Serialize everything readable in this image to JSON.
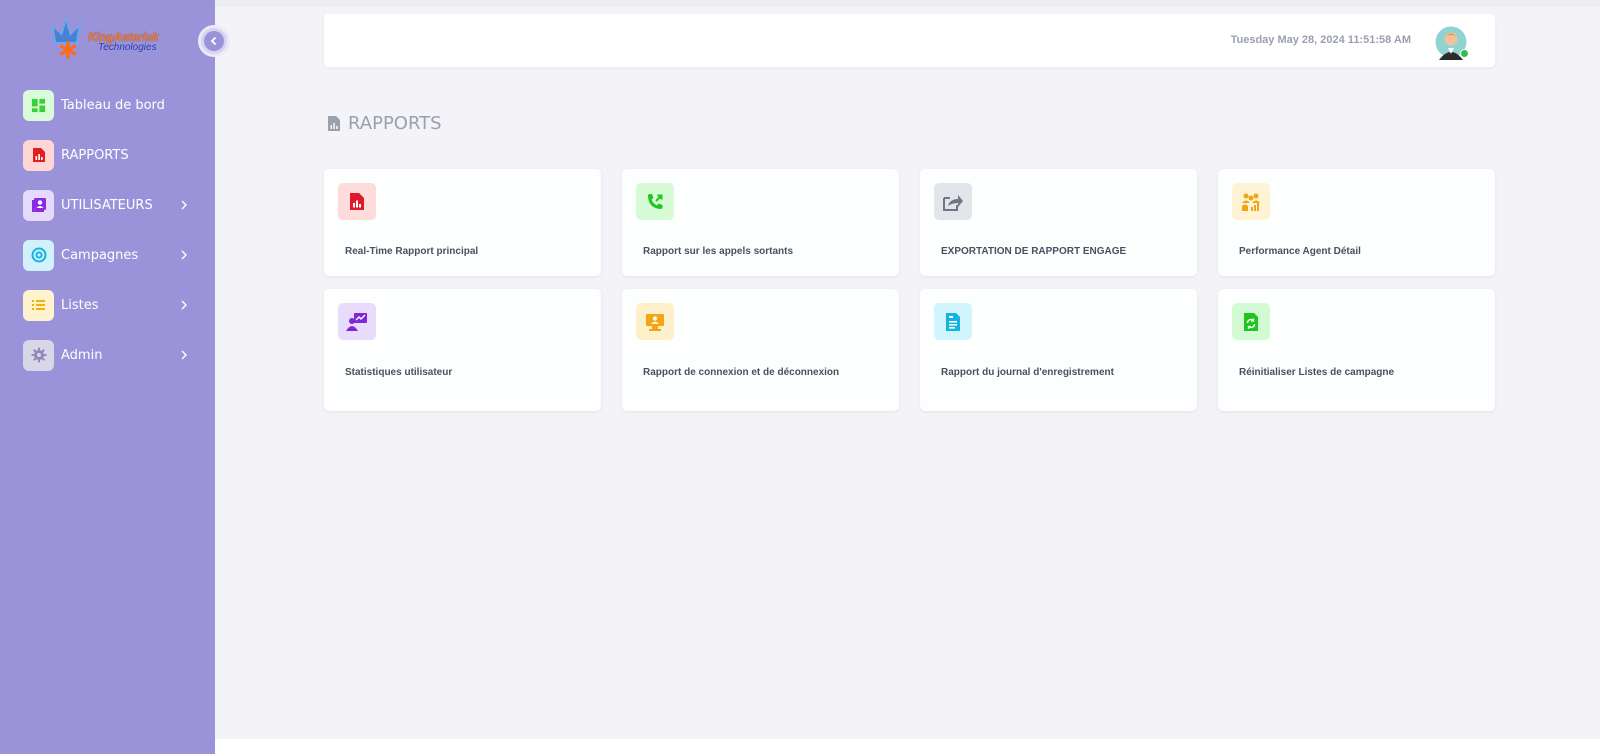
{
  "app": {
    "logo_line1": "KingAsterisk",
    "logo_line2": "Technologies"
  },
  "sidebar": {
    "items": [
      {
        "label": "Tableau de bord",
        "icon": "dashboard-icon",
        "bg": "#d9fbd9",
        "fg": "#35d135"
      },
      {
        "label": "RAPPORTS",
        "icon": "report-file-icon",
        "bg": "#ffd6d6",
        "fg": "#e01f1f"
      },
      {
        "label": "UTILISATEURS",
        "icon": "users-icon",
        "bg": "#e6dafc",
        "fg": "#8a2be2"
      },
      {
        "label": "Campagnes",
        "icon": "target-icon",
        "bg": "#d2f2fb",
        "fg": "#15b4e0"
      },
      {
        "label": "Listes",
        "icon": "list-icon",
        "bg": "#fff3cf",
        "fg": "#f0b400"
      },
      {
        "label": "Admin",
        "icon": "gear-icon",
        "bg": "#d8d6e7",
        "fg": "#8f8ab8"
      }
    ]
  },
  "header": {
    "datetime": "Tuesday May 28, 2024 11:51:58 AM"
  },
  "page": {
    "title": "RAPPORTS"
  },
  "cards": [
    {
      "label": "Real-Time Rapport principal",
      "icon": "report-chart-icon",
      "bg": "#ffdcdc",
      "fg": "#e0192b"
    },
    {
      "label": "Rapport sur les appels sortants",
      "icon": "outgoing-call-icon",
      "bg": "#d6fbd6",
      "fg": "#21c421"
    },
    {
      "label": "EXPORTATION DE RAPPORT ENGAGE",
      "icon": "export-share-icon",
      "bg": "#e2e5ea",
      "fg": "#707684"
    },
    {
      "label": "Performance Agent Détail",
      "icon": "team-performance-icon",
      "bg": "#fff3d6",
      "fg": "#f2a516"
    },
    {
      "label": "Statistiques utilisateur",
      "icon": "user-presentation-icon",
      "bg": "#e8dcfc",
      "fg": "#8125d6"
    },
    {
      "label": "Rapport de connexion et de déconnexion",
      "icon": "login-monitor-icon",
      "bg": "#fff0cc",
      "fg": "#f2a516"
    },
    {
      "label": "Rapport du journal d'enregistrement",
      "icon": "document-log-icon",
      "bg": "#d1f5fc",
      "fg": "#14b4e0"
    },
    {
      "label": "Réinitialiser Listes de campagne",
      "icon": "reset-refresh-icon",
      "bg": "#d3fbd3",
      "fg": "#20c520"
    }
  ]
}
